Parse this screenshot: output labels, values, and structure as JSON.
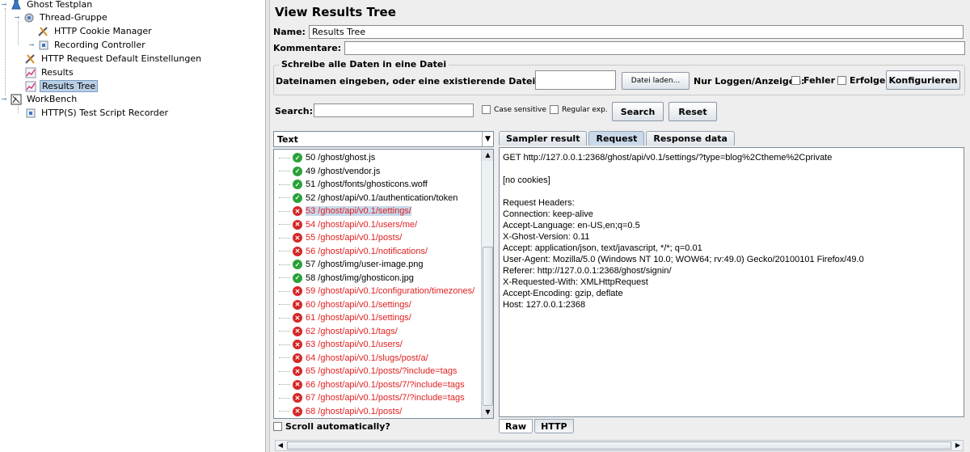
{
  "tree": {
    "items": [
      {
        "label": "Ghost Testplan",
        "icon": "flask-icon"
      },
      {
        "label": "Thread-Gruppe",
        "icon": "gear-icon"
      },
      {
        "label": "HTTP Cookie Manager",
        "icon": "tools-icon"
      },
      {
        "label": "Recording Controller",
        "icon": "controller-icon"
      },
      {
        "label": "HTTP Request Default Einstellungen",
        "icon": "tools-icon"
      },
      {
        "label": "Results",
        "icon": "graph-icon"
      },
      {
        "label": "Results Tree",
        "icon": "graph-icon"
      },
      {
        "label": "WorkBench",
        "icon": "workbench-icon"
      },
      {
        "label": "HTTP(S) Test Script Recorder",
        "icon": "controller-icon"
      }
    ]
  },
  "panel": {
    "title": "View Results Tree",
    "name_label": "Name:",
    "name_value": "Results Tree",
    "comment_label": "Kommentare:",
    "file_group_title": "Schreibe alle Daten in eine Datei",
    "file_label": "Dateinamen eingeben, oder eine existierende Datei auswählen.",
    "file_value": "",
    "browse_button": "Datei laden...",
    "log_label": "Nur Loggen/Anzeigen:",
    "errors_label": "Fehler",
    "success_label": "Erfolge",
    "configure_button": "Konfigurieren",
    "search_label": "Search:",
    "search_value": "",
    "case_sensitive_label": "Case sensitive",
    "regex_label": "Regular exp.",
    "search_button": "Search",
    "reset_button": "Reset"
  },
  "results": {
    "renderer": "Text",
    "scroll_auto_label": "Scroll automatically?",
    "items": [
      {
        "label": "50 /ghost/ghost.js",
        "status": "ok"
      },
      {
        "label": "49 /ghost/vendor.js",
        "status": "ok"
      },
      {
        "label": "51 /ghost/fonts/ghosticons.woff",
        "status": "ok"
      },
      {
        "label": "52 /ghost/api/v0.1/authentication/token",
        "status": "ok"
      },
      {
        "label": "53 /ghost/api/v0.1/settings/",
        "status": "err",
        "selected": true
      },
      {
        "label": "54 /ghost/api/v0.1/users/me/",
        "status": "err"
      },
      {
        "label": "55 /ghost/api/v0.1/posts/",
        "status": "err"
      },
      {
        "label": "56 /ghost/api/v0.1/notifications/",
        "status": "err"
      },
      {
        "label": "57 /ghost/img/user-image.png",
        "status": "ok"
      },
      {
        "label": "58 /ghost/img/ghosticon.jpg",
        "status": "ok"
      },
      {
        "label": "59 /ghost/api/v0.1/configuration/timezones/",
        "status": "err"
      },
      {
        "label": "60 /ghost/api/v0.1/settings/",
        "status": "err"
      },
      {
        "label": "61 /ghost/api/v0.1/settings/",
        "status": "err"
      },
      {
        "label": "62 /ghost/api/v0.1/tags/",
        "status": "err"
      },
      {
        "label": "63 /ghost/api/v0.1/users/",
        "status": "err"
      },
      {
        "label": "64 /ghost/api/v0.1/slugs/post/a/",
        "status": "err"
      },
      {
        "label": "65 /ghost/api/v0.1/posts/?include=tags",
        "status": "err"
      },
      {
        "label": "66 /ghost/api/v0.1/posts/7/?include=tags",
        "status": "err"
      },
      {
        "label": "67 /ghost/api/v0.1/posts/7/?include=tags",
        "status": "err"
      },
      {
        "label": "68 /ghost/api/v0.1/posts/",
        "status": "err"
      }
    ]
  },
  "detail": {
    "tabs": [
      "Sampler result",
      "Request",
      "Response data"
    ],
    "active_tab": "Request",
    "lines": [
      "GET http://127.0.0.1:2368/ghost/api/v0.1/settings/?type=blog%2Ctheme%2Cprivate",
      "",
      "[no cookies]",
      "",
      "Request Headers:",
      "Connection: keep-alive",
      "Accept-Language: en-US,en;q=0.5",
      "X-Ghost-Version: 0.11",
      "Accept: application/json, text/javascript, */*; q=0.01",
      "User-Agent: Mozilla/5.0 (Windows NT 10.0; WOW64; rv:49.0) Gecko/20100101 Firefox/49.0",
      "Referer: http://127.0.0.1:2368/ghost/signin/",
      "X-Requested-With: XMLHttpRequest",
      "Accept-Encoding: gzip, deflate",
      "Host: 127.0.0.1:2368"
    ],
    "bottom_tabs": [
      "Raw",
      "HTTP"
    ],
    "active_bottom_tab": "Raw"
  }
}
